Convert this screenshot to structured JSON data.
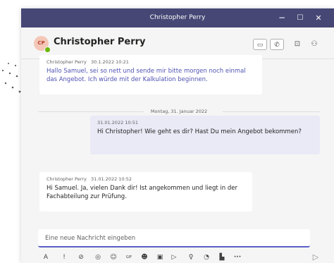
{
  "window": {
    "title": "Christopher Perry",
    "controls": {
      "minimize": "−",
      "maximize": "☐",
      "close": "✕"
    }
  },
  "header": {
    "avatar_initials": "CP",
    "name": "Christopher Perry",
    "presence_color": "#6bb700",
    "buttons": [
      {
        "icon": "video-call-icon",
        "glyph": "▭"
      },
      {
        "icon": "phone-call-icon",
        "glyph": "✆"
      }
    ],
    "extra_icons": [
      {
        "icon": "screen-share-icon",
        "glyph": "⊡"
      },
      {
        "icon": "people-settings-icon",
        "glyph": "⚇"
      }
    ]
  },
  "messages": [
    {
      "sender": "Christopher Perry",
      "timestamp": "30.1.2022 10:21",
      "text": "Hallo Samuel, sei so nett und sende mir bitte morgen noch einmal das Angebot. Ich würde mit der Kalkulation beginnen."
    },
    {
      "sender": "",
      "timestamp": "31.01.2022 10:51",
      "text": "Hi Christopher! Wie geht es dir? Hast Du mein Angebot bekommen?"
    },
    {
      "sender": "Christopher Perry",
      "timestamp": "31.01.2022 10:52",
      "text": "Hi Samuel. Ja, vielen Dank dir! Ist angekommen und liegt in der Fachabteilung zur Prüfung."
    }
  ],
  "date_separator": "Montag, 31. Januar 2022",
  "composer": {
    "placeholder": "Eine neue Nachricht eingeben"
  },
  "toolbar": [
    {
      "name": "format-icon",
      "glyph": "A"
    },
    {
      "name": "important-icon",
      "glyph": "!"
    },
    {
      "name": "attach-icon",
      "glyph": "⊘"
    },
    {
      "name": "loop-icon",
      "glyph": "◎"
    },
    {
      "name": "emoji-icon",
      "glyph": "☺"
    },
    {
      "name": "gif-icon",
      "glyph": "GIF"
    },
    {
      "name": "sticker-icon",
      "glyph": "☻"
    },
    {
      "name": "meeting-icon",
      "glyph": "▣"
    },
    {
      "name": "stream-icon",
      "glyph": "▷"
    },
    {
      "name": "praise-icon",
      "glyph": "♀"
    },
    {
      "name": "approvals-icon",
      "glyph": "◔"
    },
    {
      "name": "apps-icon",
      "glyph": "▙"
    },
    {
      "name": "more-icon",
      "glyph": "···"
    }
  ],
  "send_glyph": "▷",
  "colors": {
    "titlebar": "#464775",
    "accent": "#5b5fc7",
    "first_message_text": "#4f52b2",
    "own_bubble": "#e9eaf6"
  }
}
